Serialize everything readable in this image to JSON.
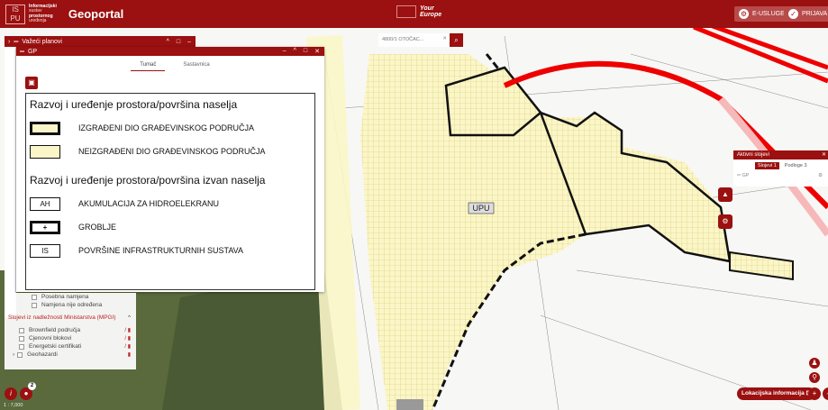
{
  "header": {
    "logo_lines": [
      "Informacijski",
      "sustav",
      "prostornog",
      "uređenja"
    ],
    "title": "Geoportal",
    "eu_label": [
      "Your",
      "Europe"
    ],
    "eusluge": "E-USLUGE",
    "prijava": "PRIJAVA"
  },
  "search": {
    "value": "4800/1 OTOČAC..."
  },
  "windows": {
    "vazeci": "Važeći planovi",
    "gp": "GP"
  },
  "tabs": [
    "Tumač",
    "Sastavnica"
  ],
  "legend": {
    "section1": "Razvoj i uređenje prostora/površina naselja",
    "items1": [
      "IZGRAĐENI DIO GRAĐEVINSKOG PODRUČJA",
      "NEIZGRAĐENI  DIO GRAĐEVINSKOG PODRUČJA"
    ],
    "section2": "Razvoj i uređenje prostora/površina izvan naselja",
    "items2": [
      {
        "sym": "AH",
        "label": "AKUMULACIJA ZA HIDROELEKRANU"
      },
      {
        "sym": "+",
        "label": "GROBLJE"
      },
      {
        "sym": "IS",
        "label": "POVRŠINE INFRASTRUKTURNIH SUSTAVA"
      }
    ]
  },
  "layers": {
    "top_items": [
      "Posebna namjena",
      "Namjena nije određena"
    ],
    "group": "Slojevi iz nadležnosti Ministarstva (MPGI)",
    "items": [
      "Brownfield područja",
      "Cjenovni blokovi",
      "Energetski certifikati",
      "Geohazardi"
    ]
  },
  "active": {
    "title": "Aktivni slojevi",
    "tab1": "Slojevi",
    "tab1_count": "1",
    "tab2": "Podloge",
    "tab2_count": "3",
    "layer": "GP"
  },
  "map": {
    "label_upu": "UPU",
    "scale": "1 : 7,000",
    "badge": "2",
    "lokacijska": "Lokacijska informacija"
  }
}
